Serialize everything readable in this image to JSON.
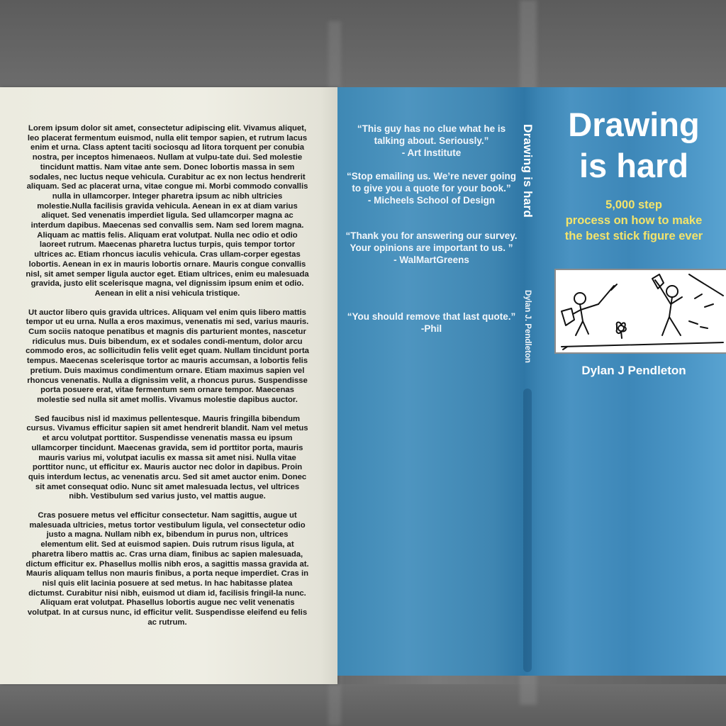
{
  "back_cover": {
    "paragraphs": [
      "Lorem ipsum dolor sit amet, consectetur adipiscing elit. Vivamus aliquet, leo placerat fermentum euismod, nulla elit tempor sapien, et rutrum lacus enim et urna. Class aptent taciti sociosqu ad litora torquent per conubia nostra, per inceptos himenaeos. Nullam at vulpu-tate dui. Sed molestie tincidunt mattis. Nam vitae ante sem. Donec lobortis massa in sem sodales, nec luctus neque vehicula. Curabitur ac ex non lectus hendrerit aliquam. Sed ac placerat urna, vitae congue mi. Morbi commodo convallis nulla in ullamcorper. Integer pharetra ipsum ac nibh ultricies molestie.Nulla facilisis gravida vehicula. Aenean in ex at diam varius aliquet. Sed venenatis imperdiet ligula. Sed ullamcorper magna ac interdum dapibus. Maecenas sed convallis sem. Nam sed lorem magna. Aliquam ac mattis felis. Aliquam erat volutpat. Nulla nec odio et odio laoreet rutrum. Maecenas pharetra luctus turpis, quis tempor tortor ultrices ac. Etiam rhoncus iaculis vehicula. Cras ullam-corper egestas lobortis. Aenean in ex in mauris lobortis ornare. Mauris congue convallis nisl, sit amet semper ligula auctor eget. Etiam ultrices, enim eu malesuada gravida, justo elit scelerisque magna, vel dignissim ipsum enim et odio. Aenean in elit a nisi vehicula tristique.",
      "Ut auctor libero quis gravida ultrices. Aliquam vel enim quis libero mattis tempor ut eu urna. Nulla a eros maximus, venenatis mi sed, varius mauris. Cum sociis natoque penatibus et magnis dis parturient montes, nascetur ridiculus mus. Duis bibendum, ex et sodales condi-mentum, dolor arcu commodo eros, ac sollicitudin felis velit eget quam. Nullam tincidunt porta tempus. Maecenas scelerisque tortor ac mauris accumsan, a lobortis felis pretium. Duis maximus condimentum ornare. Etiam maximus sapien vel rhoncus venenatis. Nulla a dignissim velit, a rhoncus purus. Suspendisse porta posuere erat, vitae fermentum sem ornare tempor. Maecenas molestie sed nulla sit amet mollis. Vivamus molestie dapibus auctor.",
      "Sed faucibus nisl id maximus pellentesque. Mauris fringilla bibendum cursus. Vivamus efficitur sapien sit amet hendrerit blandit. Nam vel metus et arcu volutpat porttitor. Suspendisse venenatis massa eu ipsum ullamcorper tincidunt. Maecenas gravida, sem id porttitor porta, mauris mauris varius mi, volutpat iaculis ex massa sit amet nisi. Nulla vitae porttitor nunc, ut efficitur ex. Mauris auctor nec dolor in dapibus. Proin quis interdum lectus, ac venenatis arcu. Sed sit amet auctor enim. Donec sit amet consequat odio. Nunc sit amet malesuada lectus, vel ultrices nibh. Vestibulum sed varius justo, vel mattis augue.",
      "Cras posuere metus vel efficitur consectetur. Nam sagittis, augue ut malesuada ultricies, metus tortor vestibulum ligula, vel consectetur odio justo a magna. Nullam nibh ex, bibendum in purus non, ultrices elementum elit. Sed at euismod sapien. Duis rutrum risus ligula, at pharetra libero mattis ac. Cras urna diam, finibus ac sapien malesuada, dictum efficitur ex. Phasellus mollis nibh eros, a sagittis massa gravida at. Mauris aliquam tellus non mauris finibus, a porta neque imperdiet. Cras in nisl quis elit lacinia posuere at sed metus. In hac habitasse platea dictumst. Curabitur nisi nibh, euismod ut diam id, facilisis fringil-la nunc. Aliquam erat volutpat. Phasellus lobortis augue nec velit venenatis volutpat. In at cursus nunc, id efficitur velit. Suspendisse eleifend eu felis ac rutrum."
    ]
  },
  "quotes": [
    "“This guy has no clue what he is talking about.   Seriously.”\n- Art Institute",
    "“Stop emailing us. We’re never going to give you a quote for your book.”\n- Micheels School of Design",
    "“Thank you for answering our survey. Your opinions are important to us. ”\n- WalMartGreens",
    "“You should remove that last quote.”\n-Phil"
  ],
  "spine": {
    "title": "Drawing is hard",
    "author": "Dylan J. Pendleton"
  },
  "front_cover": {
    "title_line1": "Drawing",
    "title_line2": "is hard",
    "subtitle_line1": "5,000 step",
    "subtitle_line2": "process on how to make",
    "subtitle_line3": "the best stick figure ever",
    "author": "Dylan J Pendleton"
  },
  "colors": {
    "cover_blue": "#3f87b6",
    "subtitle_yellow": "#f4e46a",
    "page_cream": "#ecebe0"
  }
}
